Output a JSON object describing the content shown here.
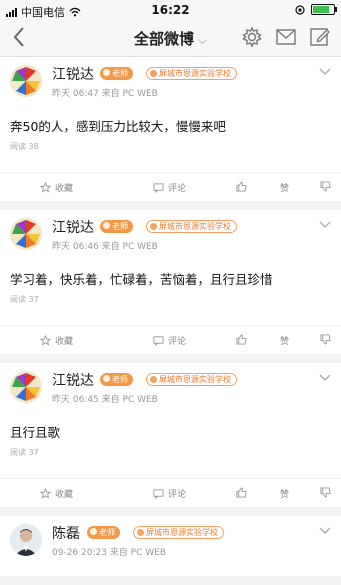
{
  "status_bar": {
    "carrier": "中国电信",
    "time": "16:22",
    "battery_level": 0.9
  },
  "nav": {
    "title": "全部微博",
    "title_chevron": "⌵"
  },
  "posts": [
    {
      "author": "江锐达",
      "teacher_badge": "老师",
      "school_badge": "屏城市恩源实验学校",
      "meta": "昨天 06:47 来自 PC WEB",
      "content": "奔50的人，感到压力比较大，慢慢来吧",
      "reads": "阅读 38",
      "actions": {
        "favorite": "收藏",
        "comment": "评论",
        "like": "赞"
      }
    },
    {
      "author": "江锐达",
      "teacher_badge": "老师",
      "school_badge": "屏城市恩源实验学校",
      "meta": "昨天 06:46 来自 PC WEB",
      "content": "学习着，快乐着，忙碌着，苦恼着，且行且珍惜",
      "reads": "阅读 37",
      "actions": {
        "favorite": "收藏",
        "comment": "评论",
        "like": "赞"
      }
    },
    {
      "author": "江锐达",
      "teacher_badge": "老师",
      "school_badge": "屏城市恩源实验学校",
      "meta": "昨天 06:45 来自 PC WEB",
      "content": "且行且歌",
      "reads": "阅读 37",
      "actions": {
        "favorite": "收藏",
        "comment": "评论",
        "like": "赞"
      }
    },
    {
      "author": "陈磊",
      "teacher_badge": "老师",
      "school_badge": "屏城市恩源实验学校",
      "meta": "09-26 20:23 来自 PC WEB"
    }
  ]
}
